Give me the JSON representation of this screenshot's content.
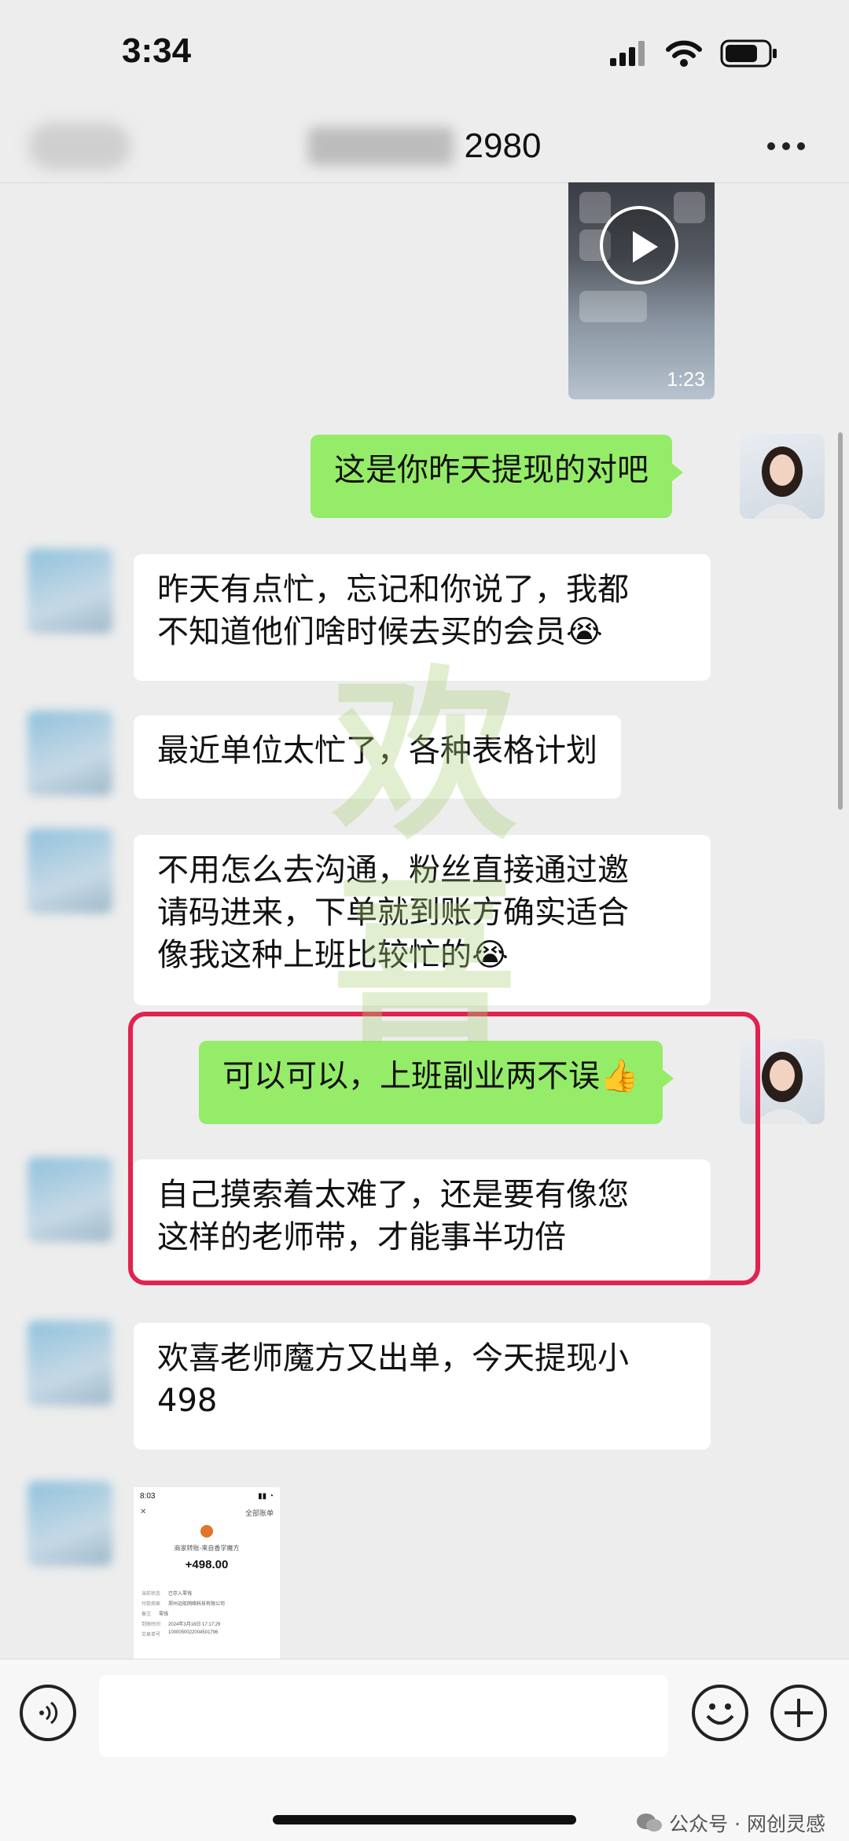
{
  "status_bar": {
    "time": "3:34"
  },
  "nav": {
    "title_suffix": "2980"
  },
  "video": {
    "duration": "1:23"
  },
  "messages": [
    {
      "side": "out",
      "text": "这是你昨天提现的对吧"
    },
    {
      "side": "in",
      "text": "昨天有点忙，忘记和你说了，我都\n不知道他们啥时候去买的会员😭"
    },
    {
      "side": "in",
      "text": "最近单位太忙了，各种表格计划"
    },
    {
      "side": "in",
      "text": "不用怎么去沟通，粉丝直接通过邀\n请码进来，下单就到账方确实适合\n像我这种上班比较忙的😭"
    },
    {
      "side": "out",
      "text": "可以可以，上班副业两不误👍"
    },
    {
      "side": "in",
      "text": "自己摸索着太难了，还是要有像您\n这样的老师带，才能事半功倍"
    },
    {
      "side": "in",
      "text": "欢喜老师魔方又出单，今天提现小\n498"
    }
  ],
  "receipt": {
    "time": "8:03",
    "all_bills": "全部账单",
    "source": "商家转账-来自香学魔方",
    "amount": "+498.00",
    "rows": [
      {
        "label": "当前状态",
        "value": "已存入零钱"
      },
      {
        "label": "付款商家",
        "value": "郑州远航网络科技有限公司"
      },
      {
        "label": "备注",
        "value": "零钱"
      },
      {
        "label": "到账时间",
        "value": "2024年3月18日 17:17:29"
      },
      {
        "label": "交易单号",
        "value": "1000050022004501796"
      }
    ]
  },
  "watermark": {
    "text": "欢喜"
  },
  "footer": {
    "watermark_text": "公众号 · 网创灵感"
  },
  "colors": {
    "bubble_out": "#95ec69",
    "bubble_in": "#ffffff",
    "highlight_border": "#e0234f",
    "background": "#ededed"
  }
}
